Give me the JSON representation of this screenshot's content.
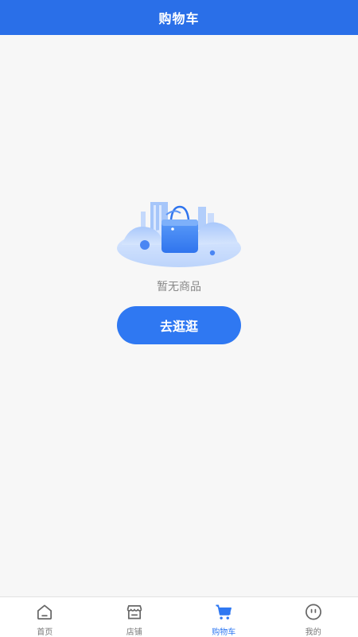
{
  "header": {
    "title": "购物车"
  },
  "empty_state": {
    "message": "暂无商品",
    "button_label": "去逛逛"
  },
  "tabbar": {
    "active_color": "#2f78f2",
    "inactive_color": "#777777",
    "items": [
      {
        "label": "首页",
        "icon": "home-icon"
      },
      {
        "label": "店铺",
        "icon": "store-icon"
      },
      {
        "label": "购物车",
        "icon": "cart-icon",
        "active": true
      },
      {
        "label": "我的",
        "icon": "profile-icon"
      }
    ]
  },
  "colors": {
    "header_bg": "#2a6fe8",
    "button_bg": "#2f78f2",
    "page_bg": "#f7f7f7"
  }
}
